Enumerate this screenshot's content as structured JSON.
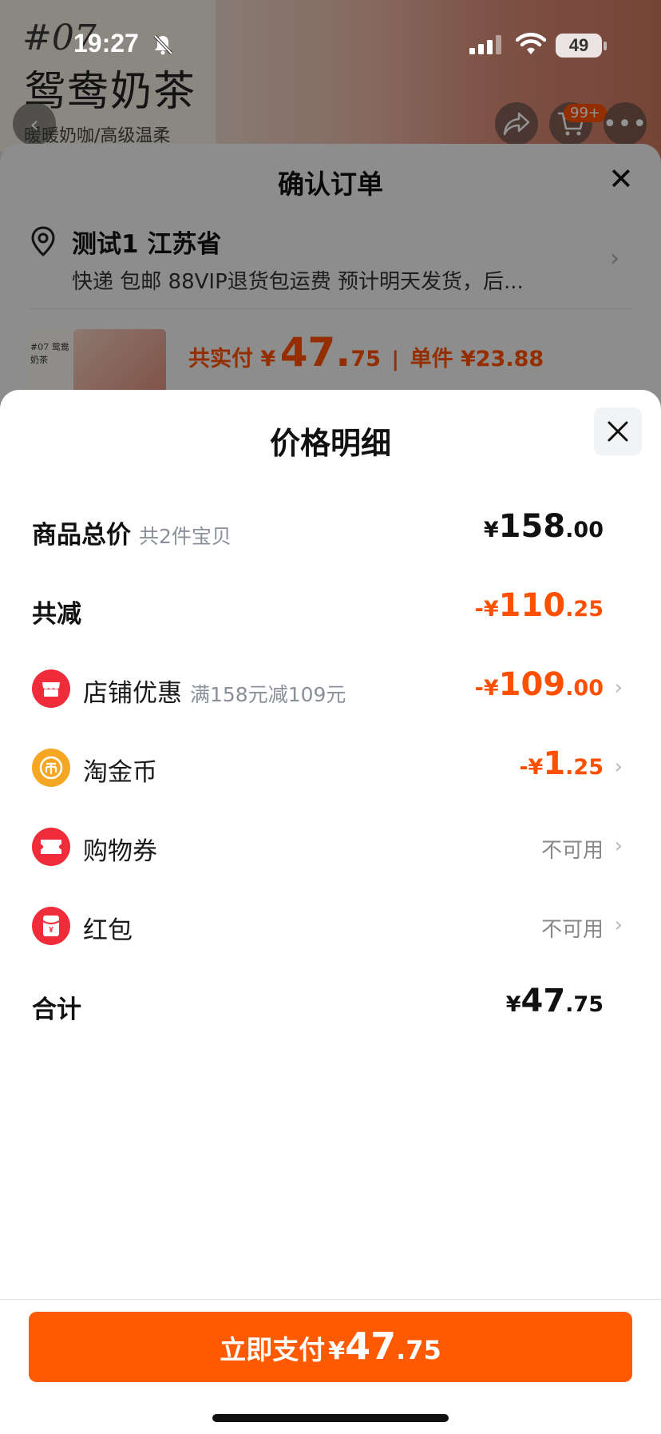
{
  "status_bar": {
    "time": "19:27",
    "battery": "49"
  },
  "background_page": {
    "poster_number": "#07",
    "poster_title": "鸳鸯奶茶",
    "poster_subtitle": "暖暖奶咖/高级温柔",
    "cart_badge": "99+",
    "thumb_text": "#07 鸳鸯奶茶"
  },
  "confirm_order": {
    "title": "确认订单",
    "address_name": "测试1 江苏省",
    "address_desc": "快递 包邮 88VIP退货包运费 预计明天发货，后...",
    "pay_prefix": "共实付 ¥",
    "pay_int": "47.",
    "pay_dec": "75",
    "unit_price": "单件 ¥23.88"
  },
  "price_detail": {
    "title": "价格明细",
    "rows": {
      "total": {
        "label": "商品总价",
        "sub": "共2件宝贝",
        "sym": "¥",
        "int": "158",
        "dec": ".00"
      },
      "discount": {
        "label": "共减",
        "sym": "-¥",
        "int": "110",
        "dec": ".25"
      },
      "shop": {
        "label": "店铺优惠",
        "sub": "满158元减109元",
        "sym": "-¥",
        "int": "109",
        "dec": ".00"
      },
      "coins": {
        "label": "淘金币",
        "sym": "-¥",
        "int": "1",
        "dec": ".25"
      },
      "coupon": {
        "label": "购物券",
        "status": "不可用"
      },
      "redpacket": {
        "label": "红包",
        "status": "不可用"
      },
      "sum": {
        "label": "合计",
        "sym": "¥",
        "int": "47",
        "dec": ".75"
      }
    }
  },
  "pay_button": {
    "label": "立即支付",
    "sym": "¥",
    "int": "47",
    "dec": ".75"
  },
  "colors": {
    "accent": "#ff5000",
    "button": "#ff5a00",
    "icon_red": "#f02b3a",
    "icon_gold": "#f5a623"
  }
}
